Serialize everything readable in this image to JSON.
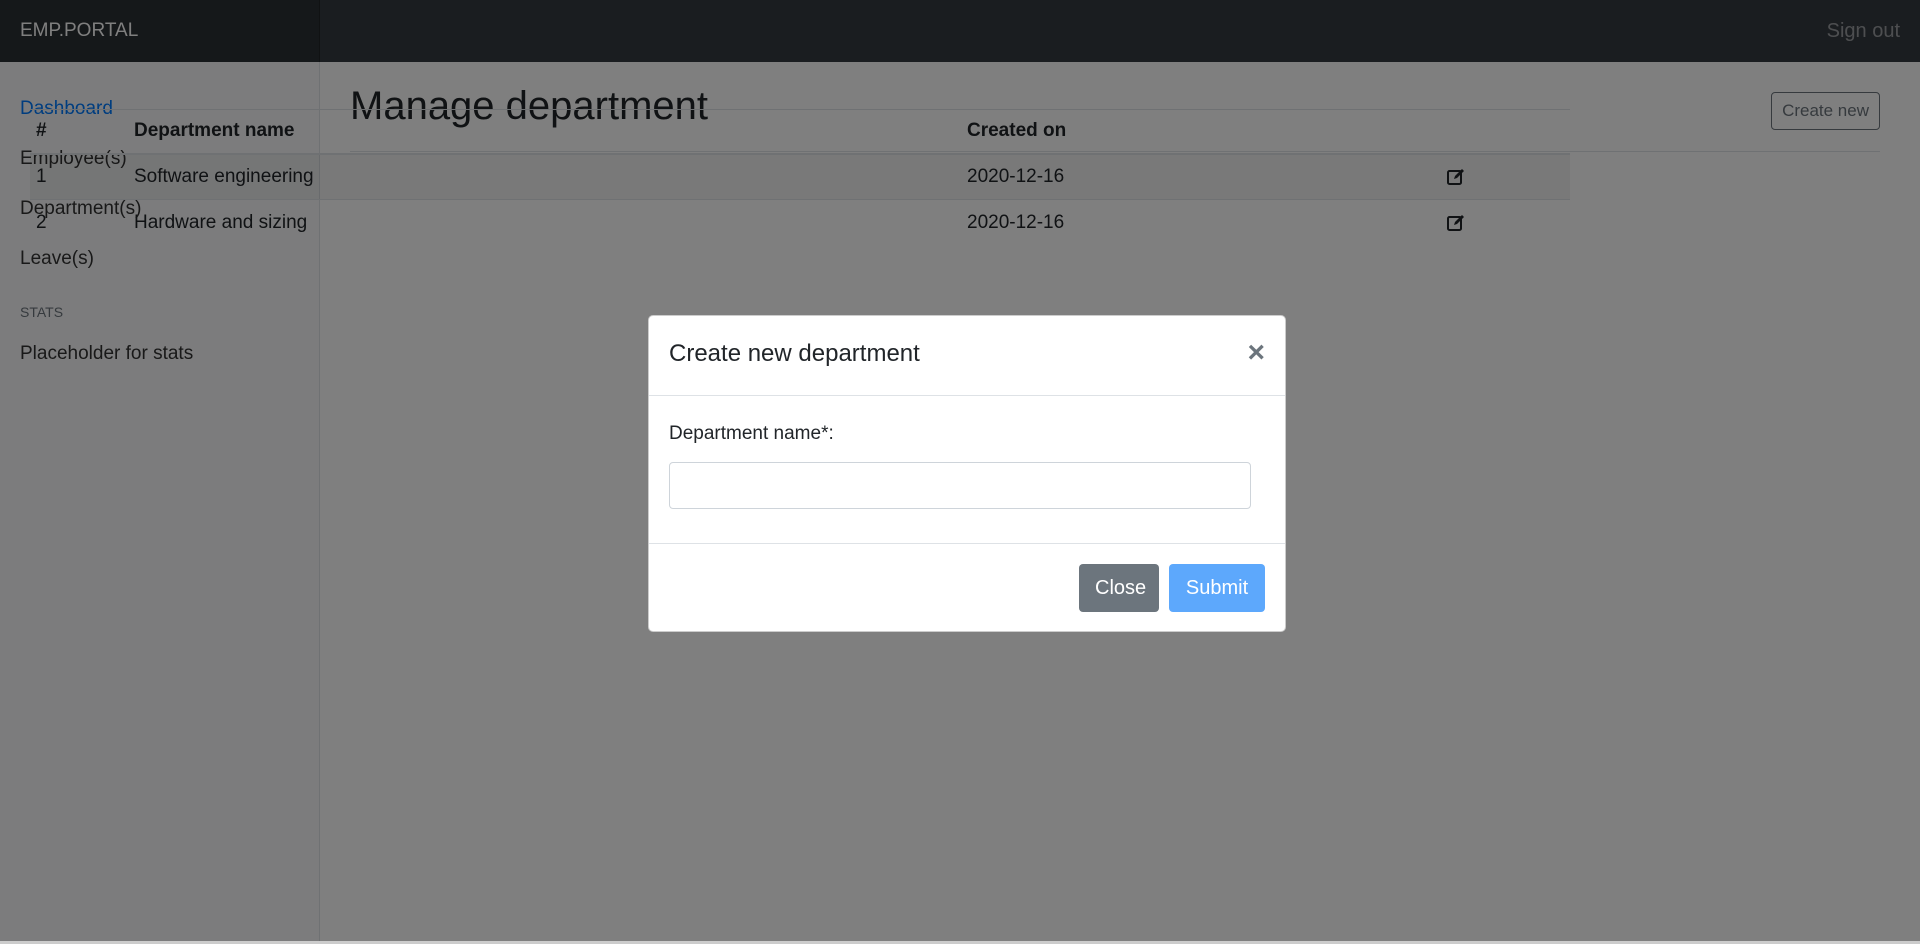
{
  "navbar": {
    "brand": "EMP.PORTAL",
    "signout": "Sign out"
  },
  "sidebar": {
    "items": [
      {
        "label": "Dashboard"
      },
      {
        "label": "Employee(s)"
      },
      {
        "label": "Department(s)"
      },
      {
        "label": "Leave(s)"
      }
    ],
    "stats_heading": "STATS",
    "stats_item": "Placeholder for stats"
  },
  "main": {
    "title": "Manage department",
    "create_button": "Create new",
    "table": {
      "headers": [
        "#",
        "Department name",
        "Created on",
        ""
      ],
      "rows": [
        {
          "num": "1",
          "name": "Software engineering",
          "created": "2020-12-16"
        },
        {
          "num": "2",
          "name": "Hardware and sizing",
          "created": "2020-12-16"
        }
      ]
    }
  },
  "modal": {
    "title": "Create new department",
    "close_symbol": "×",
    "field_label": "Department name*:",
    "field_value": "",
    "close_button": "Close",
    "submit_button": "Submit"
  },
  "colors": {
    "navbar": "#343a40",
    "active_link": "#007bff",
    "submit": "#5da8fc",
    "close": "#6c757d"
  },
  "icons": {
    "edit": "edit-icon"
  }
}
